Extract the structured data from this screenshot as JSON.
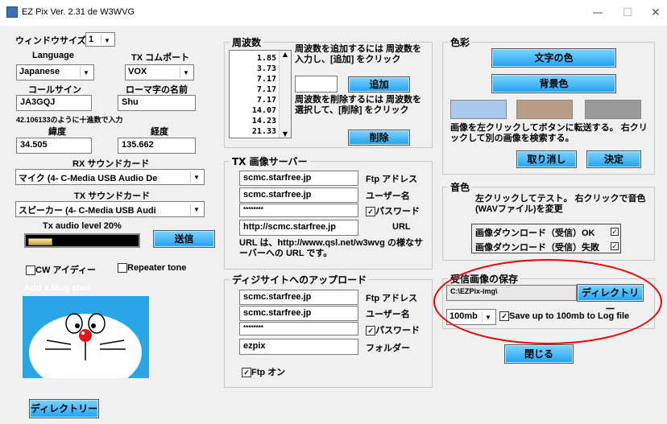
{
  "window": {
    "title": "EZ Pix   Ver. 2.31 de W3WVG",
    "minimize": "—",
    "maximize": "☐",
    "close": "✕"
  },
  "left": {
    "window_size_label": "ウィンドウサイズ",
    "window_size_value": "1",
    "language_label": "Language",
    "language_value": "Japanese",
    "tx_com_label": "TX コムポート",
    "tx_com_value": "VOX",
    "callsign_label": "コールサイン",
    "callsign_value": "JA3GQJ",
    "roman_name_label": "ローマ字の名前",
    "roman_name_value": "Shu",
    "decimal_hint": "42.106133のように十進数で入力",
    "latitude_label": "緯度",
    "longitude_label": "経度",
    "latitude_value": "34.505",
    "longitude_value": "135.662",
    "rx_card_label": "RX サウンドカード",
    "rx_card_value": "マイク (4- C-Media USB Audio De",
    "tx_card_label": "TX サウンドカード",
    "tx_card_value": "スピーカー (4- C-Media USB Audi",
    "tx_level_label": "Tx audio level  20%",
    "tx_level_fraction": 0.2,
    "send_button": "送信",
    "cw_id_label": "CW アイディー",
    "repeater_tone_label": "Repeater tone",
    "mug_shot_label": "Add a Mug shot",
    "directory_button": "ディレクトリー"
  },
  "frequency": {
    "title": "周波数",
    "items": [
      "1.85",
      "3.73",
      "7.17",
      "7.17",
      "7.17",
      "14.07",
      "14.23",
      "21.33"
    ],
    "add_hint": "周波数を追加するには 周波数を入力し、[追加] をクリック",
    "add_input": "",
    "add_button": "追加",
    "delete_hint": "周波数を削除するには 周波数を選択して、[削除] をクリック",
    "delete_button": "削除"
  },
  "tx_server": {
    "title": "TX 画像サーバー",
    "ftp_address": "scmc.starfree.jp",
    "ftp_address_label": "Ftp アドレス",
    "username": "scmc.starfree.jp",
    "username_label": "ユーザー名",
    "password": "********",
    "password_label": "パスワード",
    "url": "http://scmc.starfree.jp",
    "url_label": "URL",
    "url_hint": "URL は、http://www.qsl.net/w3wvg の様なサーバーへの URL です。"
  },
  "digisite": {
    "title": "ディジサイトへのアップロード",
    "ftp_address": "scmc.starfree.jp",
    "ftp_address_label": "Ftp アドレス",
    "username": "scmc.starfree.jp",
    "username_label": "ユーザー名",
    "password": "********",
    "password_label": "パスワード",
    "folder": "ezpix",
    "folder_label": "フォルダー",
    "ftp_on_label": "Ftp オン"
  },
  "colors": {
    "title": "色彩",
    "text_color_button": "文字の色",
    "bg_color_button": "背景色",
    "swatches": [
      "#a9c8ee",
      "#b79d86",
      "#9a9a9a"
    ],
    "hint": "画像を左クリックしてボタンに転送する。 右クリックして別の画像を検索する。",
    "cancel_button": "取り消し",
    "ok_button": "決定"
  },
  "sound": {
    "title": "音色",
    "hint": "左クリックしてテスト。 右クリックで音色(WAVファイル)を変更",
    "ok_label": "画像ダウンロード（受信）OK",
    "fail_label": "画像ダウンロード（受信）失敗"
  },
  "save": {
    "title": "受信画像の保存",
    "path": "C:\\EZPix-img\\",
    "directory_button": "ディレクトリー",
    "size_value": "100mb",
    "log_label": "Save up to 100mb to Log file"
  },
  "close_button": "閉じる",
  "accent_color": "#1fa3f0",
  "highlight_color": "#e00000"
}
